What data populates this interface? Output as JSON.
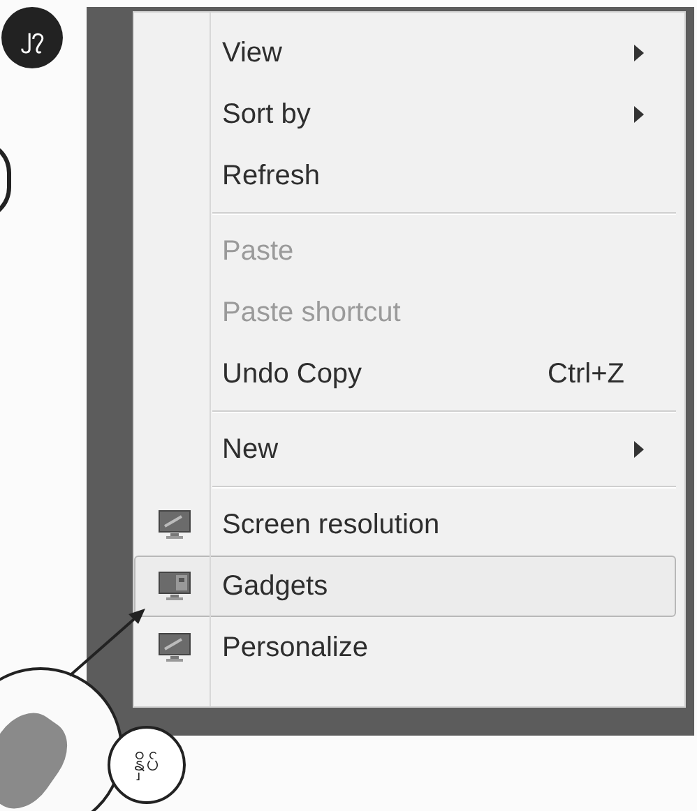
{
  "step_badge": {
    "text": "၂၇"
  },
  "click_label": {
    "text": "နှိပ်"
  },
  "menu": {
    "groups": [
      {
        "items": [
          {
            "label": "View",
            "kind": "submenu",
            "disabled": false,
            "selected": false
          },
          {
            "label": "Sort by",
            "kind": "submenu",
            "disabled": false,
            "selected": false
          },
          {
            "label": "Refresh",
            "kind": "command",
            "disabled": false,
            "selected": false
          }
        ]
      },
      {
        "items": [
          {
            "label": "Paste",
            "kind": "command",
            "disabled": true,
            "selected": false
          },
          {
            "label": "Paste shortcut",
            "kind": "command",
            "disabled": true,
            "selected": false
          },
          {
            "label": "Undo Copy",
            "kind": "command",
            "disabled": false,
            "selected": false,
            "shortcut": "Ctrl+Z"
          }
        ]
      },
      {
        "items": [
          {
            "label": "New",
            "kind": "submenu",
            "disabled": false,
            "selected": false
          }
        ]
      },
      {
        "items": [
          {
            "label": "Screen resolution",
            "kind": "icon_command",
            "disabled": false,
            "selected": false
          },
          {
            "label": "Gadgets",
            "kind": "icon_command",
            "disabled": false,
            "selected": true
          },
          {
            "label": "Personalize",
            "kind": "icon_command",
            "disabled": false,
            "selected": false
          }
        ]
      }
    ]
  }
}
